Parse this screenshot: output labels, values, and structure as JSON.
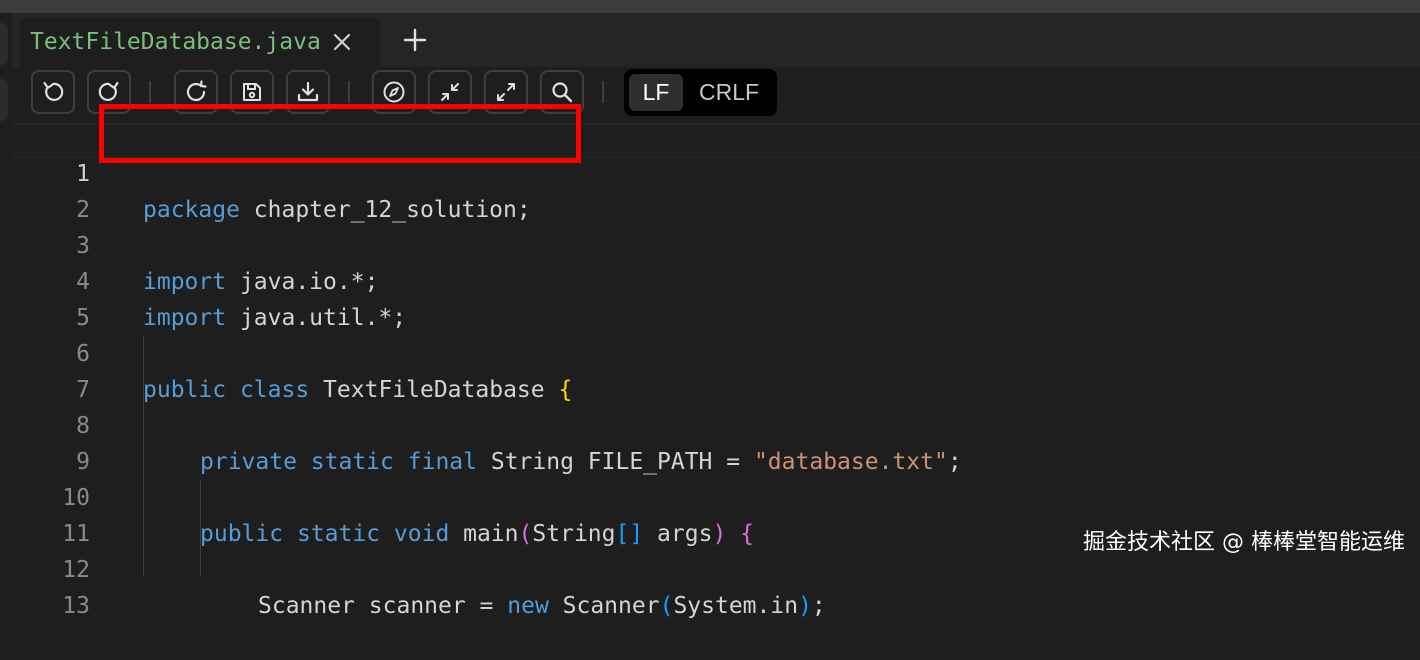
{
  "tab": {
    "title": "TextFileDatabase.java",
    "close_icon": "close-icon"
  },
  "toolbar": {
    "buttons": [
      "undo-icon",
      "redo-icon",
      "refresh-icon",
      "save-icon",
      "download-icon",
      "compass-icon",
      "collapse-icon",
      "expand-icon",
      "search-icon"
    ],
    "line_endings": {
      "options": [
        "LF",
        "CRLF"
      ],
      "selected": "LF"
    }
  },
  "editor": {
    "line_numbers": [
      "1",
      "2",
      "3",
      "4",
      "5",
      "6",
      "7",
      "8",
      "9",
      "10",
      "11",
      "12",
      "13"
    ],
    "active_line": "1",
    "highlight_color": "#ff0000",
    "lines": {
      "l1": {
        "kw": "package",
        "rest": " chapter_12_solution;"
      },
      "l3": {
        "kw": "import",
        "rest": " java.io.*;"
      },
      "l4": {
        "kw": "import",
        "rest": " java.util.*;"
      },
      "l6": {
        "kw1": "public",
        "kw2": "class",
        "name": " TextFileDatabase ",
        "brace": "{"
      },
      "l8": {
        "kw1": "private",
        "kw2": "static",
        "kw3": "final",
        "rest": " String FILE_PATH = ",
        "str": "\"database.txt\"",
        "end": ";"
      },
      "l10": {
        "kw1": "public",
        "kw2": "static",
        "kw3": "void",
        "name": " main",
        "p1": "(",
        "type": "String",
        "arr": "[]",
        "arg": " args",
        "p2": ")",
        "sp": " ",
        "brace": "{"
      },
      "l12": {
        "t1": "Scanner scanner = ",
        "kw": "new",
        "t2": " Scanner",
        "p1": "(",
        "t3": "System.in",
        "p2": ")",
        "end": ";"
      }
    }
  },
  "watermark": "掘金技术社区 @ 棒棒堂智能运维"
}
